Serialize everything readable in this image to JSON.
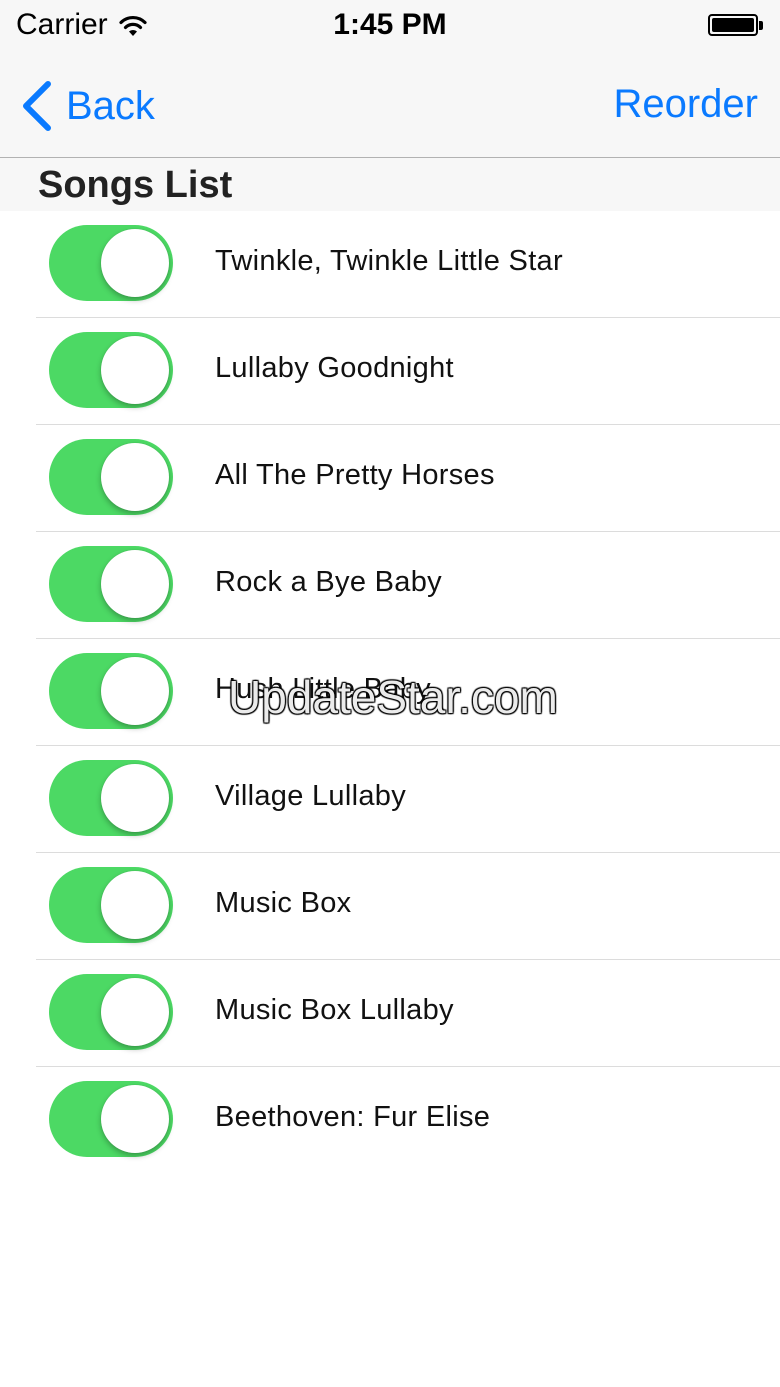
{
  "status_bar": {
    "carrier": "Carrier",
    "time": "1:45 PM"
  },
  "nav": {
    "back_label": "Back",
    "reorder_label": "Reorder",
    "accent_color": "#0a7aff"
  },
  "section": {
    "title": "Songs List"
  },
  "songs": [
    {
      "title": "Twinkle, Twinkle Little Star",
      "enabled": true
    },
    {
      "title": "Lullaby Goodnight",
      "enabled": true
    },
    {
      "title": "All The Pretty Horses",
      "enabled": true
    },
    {
      "title": "Rock a Bye Baby",
      "enabled": true
    },
    {
      "title": "Hush Little Baby",
      "enabled": true
    },
    {
      "title": "Village Lullaby",
      "enabled": true
    },
    {
      "title": "Music Box",
      "enabled": true
    },
    {
      "title": "Music Box Lullaby",
      "enabled": true
    },
    {
      "title": "Beethoven: Fur Elise",
      "enabled": true
    }
  ],
  "toggle_on_color": "#4cd964",
  "watermark": "UpdateStar.com"
}
